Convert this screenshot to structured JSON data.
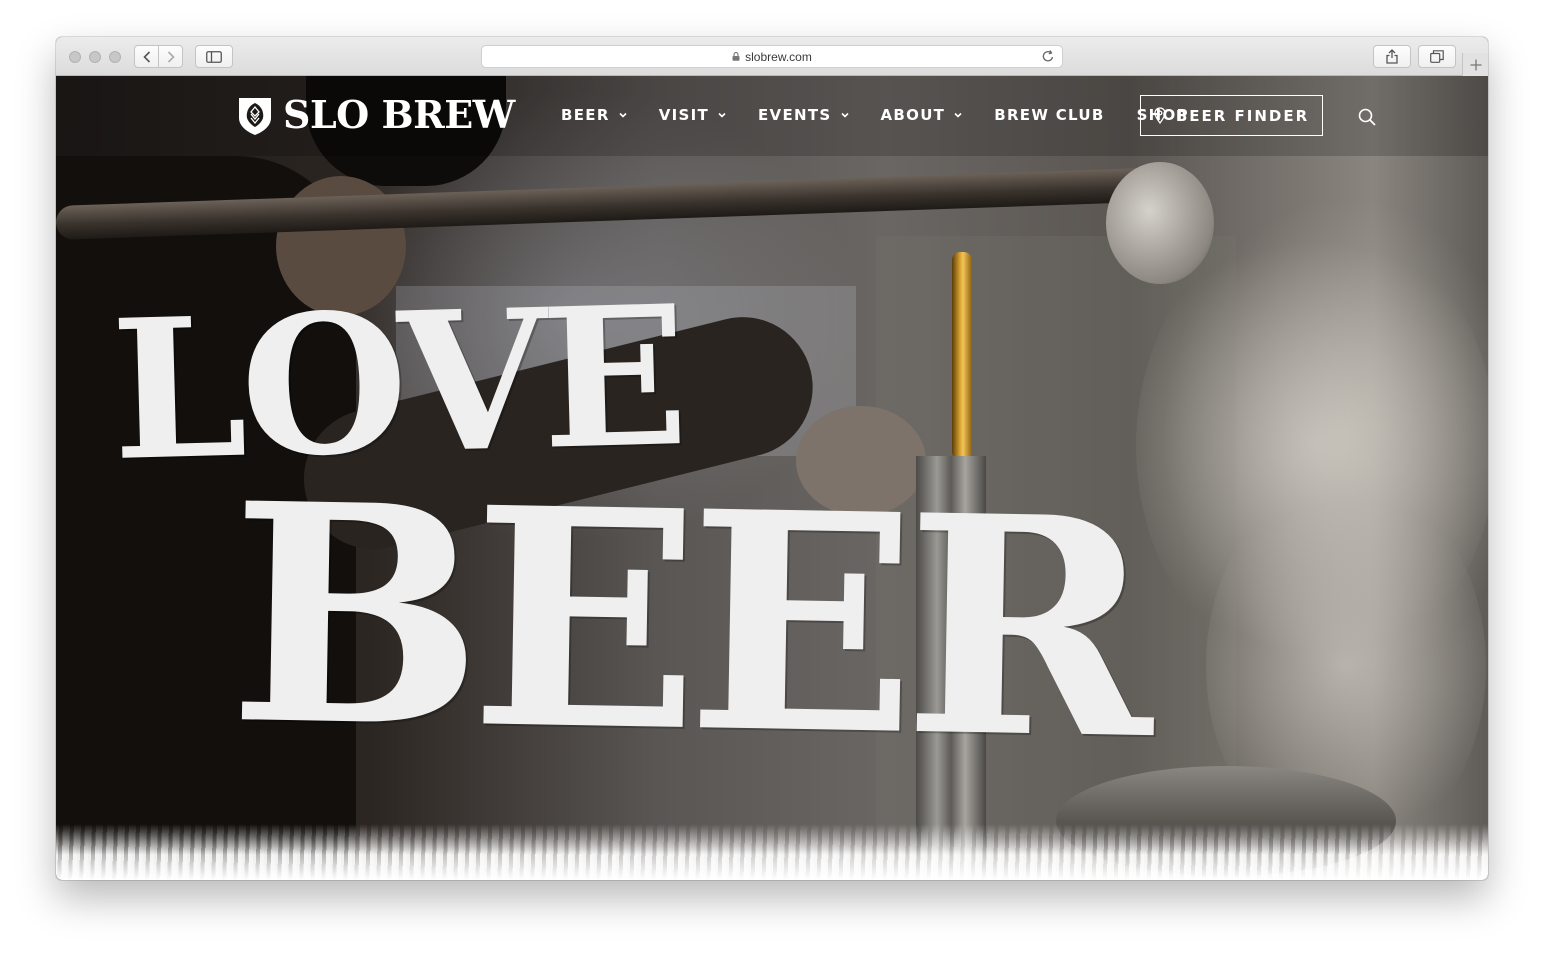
{
  "browser": {
    "url": "slobrew.com"
  },
  "site": {
    "logo_text": "SLO BREW",
    "nav": [
      {
        "label": "BEER",
        "dropdown": true
      },
      {
        "label": "VISIT",
        "dropdown": true
      },
      {
        "label": "EVENTS",
        "dropdown": true
      },
      {
        "label": "ABOUT",
        "dropdown": true
      },
      {
        "label": "BREW CLUB",
        "dropdown": false
      },
      {
        "label": "SHOP",
        "dropdown": false
      }
    ],
    "beer_finder_label": "BEER FINDER"
  },
  "hero": {
    "headline_line1": "LOVE",
    "headline_line2": "BEER"
  },
  "colors": {
    "header_text": "#ffffff",
    "headline_text": "#efefef",
    "pour_accent": "#d7a232"
  },
  "icons": [
    "back-icon",
    "forward-icon",
    "sidebar-icon",
    "lock-icon",
    "reload-icon",
    "share-icon",
    "tabs-icon",
    "plus-icon",
    "hop-logo-icon",
    "chevron-down-icon",
    "map-pin-icon",
    "search-icon"
  ]
}
